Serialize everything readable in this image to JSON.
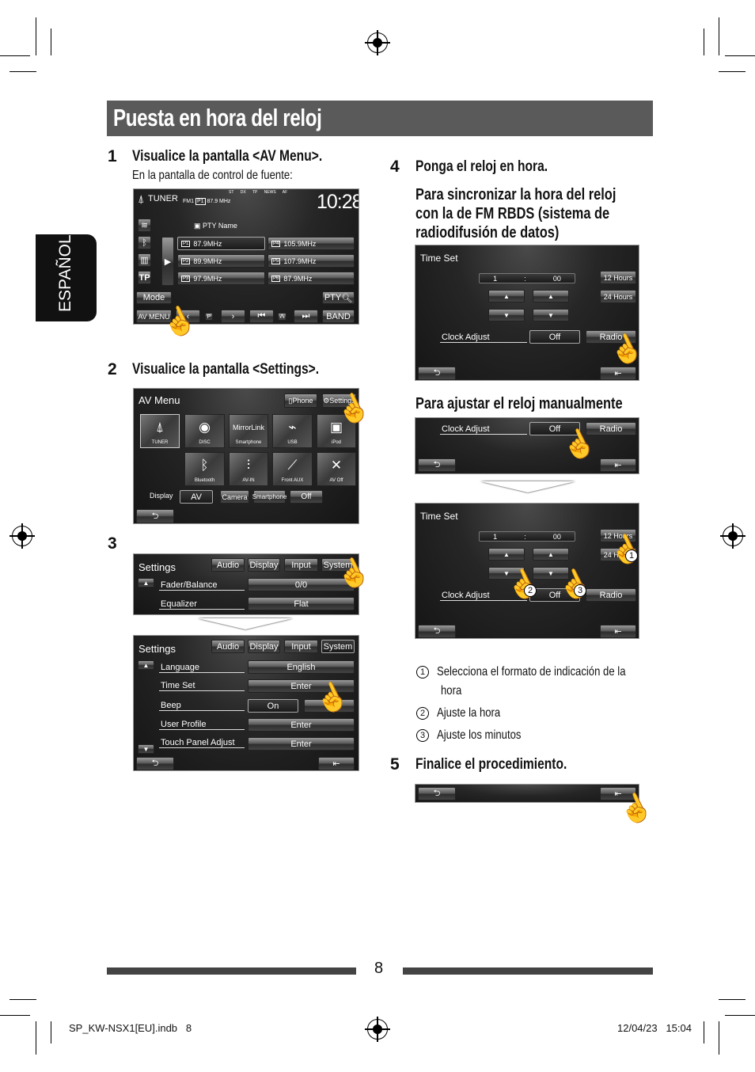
{
  "header": {
    "title": "Puesta en hora del reloj"
  },
  "side_tab": "ESPAÑOL",
  "steps": [
    {
      "num": "1",
      "title": "Visualice la pantalla <AV Menu>.",
      "sub": "En la pantalla de control de fuente:"
    },
    {
      "num": "2",
      "title": "Visualice la pantalla <Settings>."
    },
    {
      "num": "3"
    },
    {
      "num": "4",
      "title": "Ponga el reloj en hora."
    },
    {
      "num": "5",
      "title": "Finalice el procedimiento."
    }
  ],
  "sections": {
    "sync_title": [
      "Para sincronizar la hora del reloj",
      "con la de FM RBDS (sistema de",
      "radiodifusión de datos)"
    ],
    "manual_title": "Para ajustar el reloj manualmente"
  },
  "tuner_screen": {
    "source": "TUNER",
    "band": "FM1",
    "preset": "P1",
    "freq": "87.9 MHz",
    "indicators": [
      "ST",
      "DX",
      "TP",
      "NEWS",
      "AF"
    ],
    "clock": "10:28",
    "pty_name": "PTY Name",
    "tp": "TP",
    "presets": [
      {
        "p": "P1",
        "f": "87.9MHz"
      },
      {
        "p": "P4",
        "f": "105.9MHz"
      },
      {
        "p": "P2",
        "f": "89.9MHz"
      },
      {
        "p": "P5",
        "f": "107.9MHz"
      },
      {
        "p": "P3",
        "f": "97.9MHz"
      },
      {
        "p": "P6",
        "f": "87.9MHz"
      }
    ],
    "mode": "Mode",
    "pty": "PTY",
    "av_menu": "AV MENU",
    "p": "P",
    "band_btn": "BAND"
  },
  "av_menu": {
    "title": "AV Menu",
    "phone": "Phone",
    "settings": "Settings",
    "sources": [
      "TUNER",
      "DISC",
      "Smartphone",
      "USB",
      "iPod",
      "Bluetooth",
      "AV-IN",
      "Front AUX",
      "AV Off"
    ],
    "mirrorlink": "MirrorLink",
    "display_label": "Display",
    "display_options": [
      "AV",
      "Camera",
      "Smartphone",
      "Off"
    ],
    "display_selected": "AV"
  },
  "settings": {
    "title": "Settings",
    "tabs": [
      "Audio",
      "Display",
      "Input",
      "System"
    ],
    "audio_rows": [
      {
        "label": "Fader/Balance",
        "value": "0/0"
      },
      {
        "label": "Equalizer",
        "value": "Flat"
      }
    ],
    "system_rows": [
      {
        "label": "Language",
        "value": "English"
      },
      {
        "label": "Time Set",
        "value": "Enter"
      },
      {
        "label": "Beep",
        "value": "On"
      },
      {
        "label": "User Profile",
        "value": "Enter"
      },
      {
        "label": "Touch Panel Adjust",
        "value": "Enter"
      }
    ]
  },
  "time_set": {
    "title": "Time Set",
    "hour": "1",
    "sep": ":",
    "minute": "00",
    "h12": "12 Hours",
    "h24": "24 Hours",
    "clock_adjust": "Clock Adjust",
    "off": "Off",
    "radio": "Radio"
  },
  "legend": [
    {
      "n": "1",
      "text": "Selecciona el formato de indicación de la",
      "text2": "hora"
    },
    {
      "n": "2",
      "text": "Ajuste la hora"
    },
    {
      "n": "3",
      "text": "Ajuste los minutos"
    }
  ],
  "footer": {
    "page": "8",
    "file": "SP_KW-NSX1[EU].indb   8",
    "date": "12/04/23   15:04"
  },
  "colors": {
    "header_bg": "#5a5a5a",
    "tab_bg": "#111111",
    "screen_bg": "#1e1e1e"
  }
}
